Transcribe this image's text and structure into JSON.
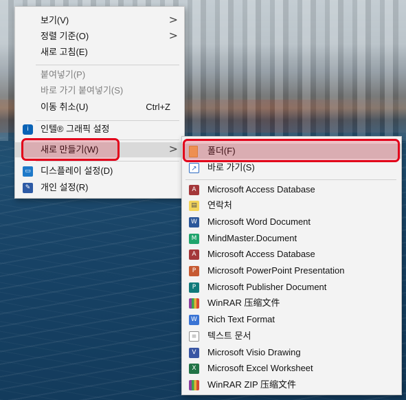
{
  "main_menu": {
    "items": [
      {
        "label": "보기(V)",
        "submenu": true
      },
      {
        "label": "정렬 기준(O)",
        "submenu": true
      },
      {
        "label": "새로 고침(E)"
      },
      {
        "label": "붙여넣기(P)",
        "disabled": true
      },
      {
        "label": "바로 가기 붙여넣기(S)",
        "disabled": true
      },
      {
        "label": "이동 취소(U)",
        "shortcut": "Ctrl+Z"
      },
      {
        "label": "인텔® 그래픽 설정",
        "icon": "intel-graphics-icon"
      },
      {
        "label": "새로 만들기(W)",
        "submenu": true,
        "highlighted": true
      },
      {
        "label": "디스플레이 설정(D)",
        "icon": "display-icon"
      },
      {
        "label": "개인 설정(R)",
        "icon": "personalize-icon"
      }
    ]
  },
  "submenu": {
    "items": [
      {
        "label": "폴더(F)",
        "icon": "folder-icon",
        "highlighted": true
      },
      {
        "label": "바로 가기(S)",
        "icon": "shortcut-icon"
      },
      {
        "label": "Microsoft Access Database",
        "icon": "access-icon"
      },
      {
        "label": "연락처",
        "icon": "contact-icon"
      },
      {
        "label": "Microsoft Word Document",
        "icon": "word-icon"
      },
      {
        "label": "MindMaster.Document",
        "icon": "mindmaster-icon"
      },
      {
        "label": "Microsoft Access Database",
        "icon": "access-icon"
      },
      {
        "label": "Microsoft PowerPoint Presentation",
        "icon": "powerpoint-icon"
      },
      {
        "label": "Microsoft Publisher Document",
        "icon": "publisher-icon"
      },
      {
        "label": "WinRAR 压缩文件",
        "icon": "winrar-icon"
      },
      {
        "label": "Rich Text Format",
        "icon": "rtf-icon"
      },
      {
        "label": "텍스트 문서",
        "icon": "text-document-icon"
      },
      {
        "label": "Microsoft Visio Drawing",
        "icon": "visio-icon"
      },
      {
        "label": "Microsoft Excel Worksheet",
        "icon": "excel-icon"
      },
      {
        "label": "WinRAR ZIP 压缩文件",
        "icon": "winrar-zip-icon"
      }
    ]
  },
  "icons": {
    "submenu_arrow": ">",
    "intel": "i",
    "display": "▭",
    "personal": "✎",
    "shortcut": "↗",
    "access": "A",
    "contact": "▤",
    "word": "W",
    "mindmaster": "M",
    "powerpoint": "P",
    "publisher": "P",
    "winrar": "",
    "rtf": "W",
    "text": "≡",
    "visio": "V",
    "excel": "X"
  },
  "colors": {
    "highlight_red": "#e2001a",
    "menu_bg": "#f3f3f3"
  }
}
